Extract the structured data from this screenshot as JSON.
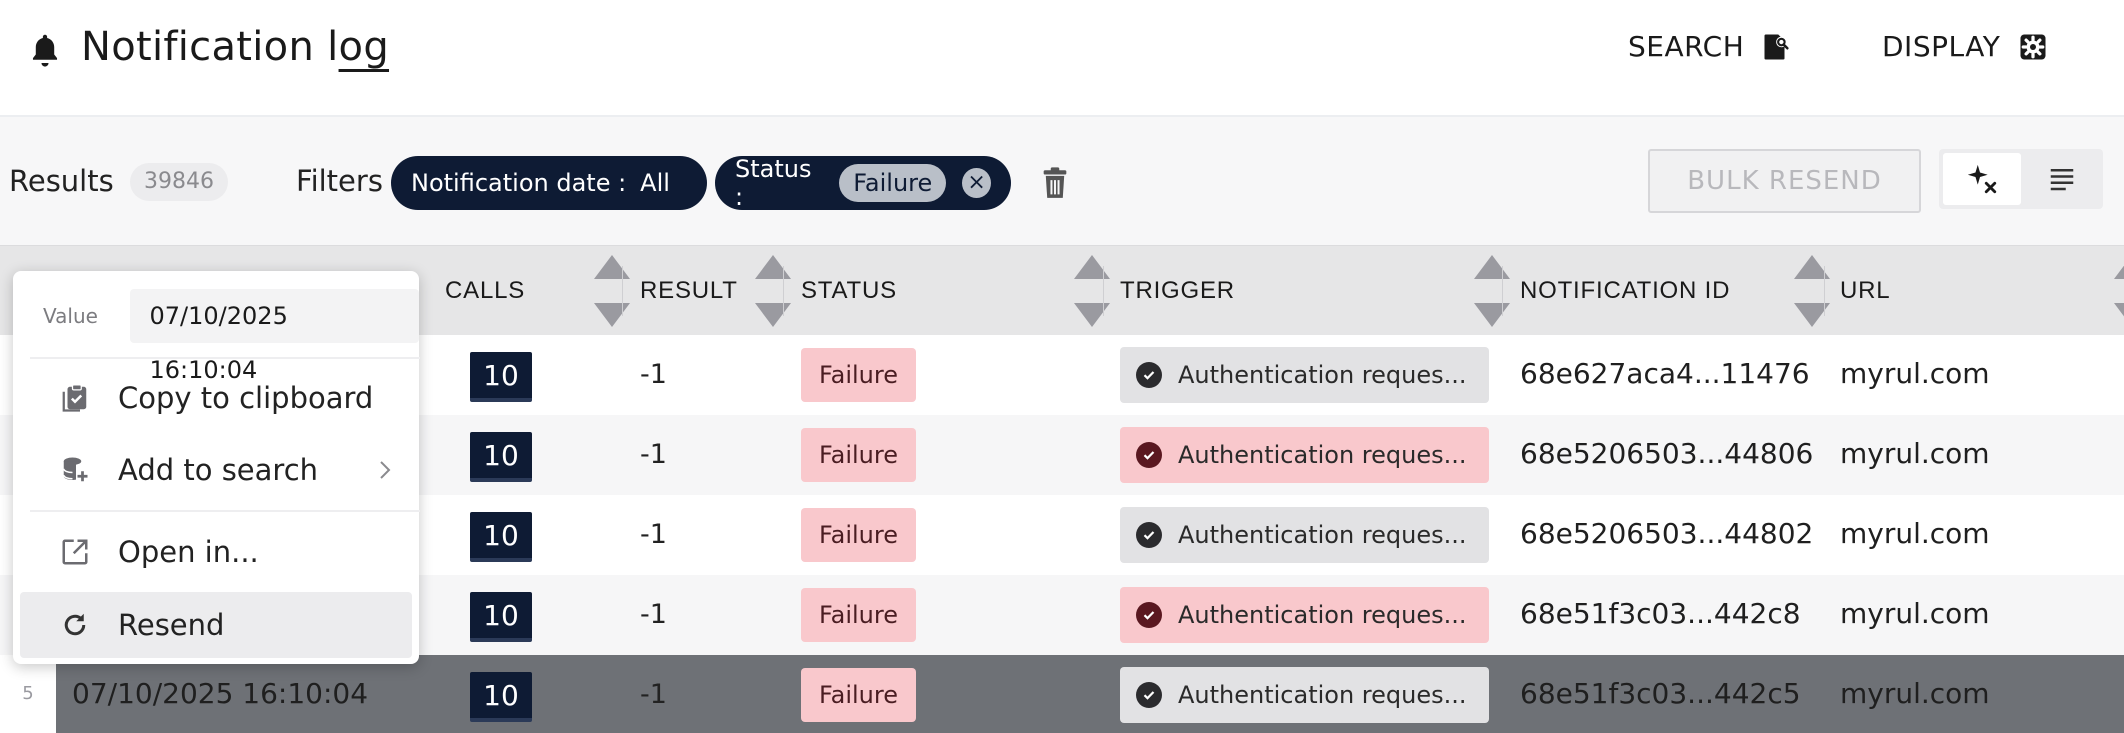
{
  "header": {
    "bell_icon": "bell-icon",
    "title_a": "Notification l",
    "title_b": "og",
    "search_label": "SEARCH",
    "display_label": "DISPLAY"
  },
  "toolbar": {
    "results_label": "Results",
    "results_count": "39846",
    "filters_label": "Filters",
    "chip_date_label": "Notification date :",
    "chip_date_value": "All",
    "chip_status_label": "Status :",
    "chip_status_value": "Failure",
    "clear_icon": "⨯",
    "bulk_resend_label": "BULK RESEND"
  },
  "table": {
    "columns": [
      "CALLS",
      "RESULT",
      "STATUS",
      "TRIGGER",
      "NOTIFICATION ID",
      "URL"
    ],
    "rows": [
      {
        "num": "",
        "date": "",
        "calls": "10",
        "result": "-1",
        "status": "Failure",
        "trigger": "Authentication reques...",
        "trigger_status": "neutral",
        "notification_id": "68e627aca4...11476",
        "url": "myrul.com"
      },
      {
        "num": "",
        "date": "",
        "calls": "10",
        "result": "-1",
        "status": "Failure",
        "trigger": "Authentication reques...",
        "trigger_status": "failure",
        "notification_id": "68e5206503...44806",
        "url": "myrul.com"
      },
      {
        "num": "",
        "date": "",
        "calls": "10",
        "result": "-1",
        "status": "Failure",
        "trigger": "Authentication reques...",
        "trigger_status": "neutral",
        "notification_id": "68e5206503...44802",
        "url": "myrul.com"
      },
      {
        "num": "",
        "date": "",
        "calls": "10",
        "result": "-1",
        "status": "Failure",
        "trigger": "Authentication reques...",
        "trigger_status": "failure",
        "notification_id": "68e51f3c03...442c8",
        "url": "myrul.com"
      },
      {
        "num": "5",
        "date": "07/10/2025 16:10:04",
        "calls": "10",
        "result": "-1",
        "status": "Failure",
        "trigger": "Authentication reques...",
        "trigger_status": "neutral",
        "notification_id": "68e51f3c03...442c5",
        "url": "myrul.com"
      }
    ]
  },
  "context_menu": {
    "value_label": "Value",
    "value": "07/10/2025 16:10:04",
    "items": [
      {
        "label": "Copy to clipboard",
        "icon": "clipboard-check-icon"
      },
      {
        "label": "Add to search",
        "icon": "database-plus-icon"
      },
      {
        "label": "Open in...",
        "icon": "open-external-icon"
      },
      {
        "label": "Resend",
        "icon": "refresh-icon"
      }
    ]
  },
  "colors": {
    "navy": "#0e1b34",
    "failure_bg": "#f9c8cc",
    "selected_row": "#6e7176"
  }
}
